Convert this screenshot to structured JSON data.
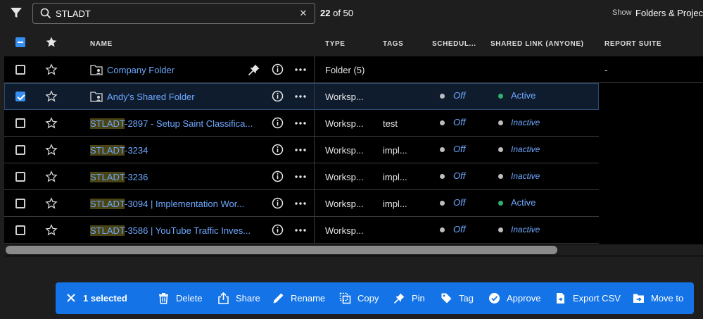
{
  "search": {
    "value": "STLADT",
    "clear_symbol": "✕"
  },
  "result_count": {
    "shown": "22",
    "of_label": "of 50"
  },
  "show": {
    "label": "Show",
    "value": "Folders & Projects"
  },
  "columns": {
    "name": "NAME",
    "type": "TYPE",
    "tags": "TAGS",
    "scheduled": "SCHEDUL...",
    "shared_link": "SHARED LINK (ANYONE)",
    "report_suite": "REPORT SUITE"
  },
  "rows": [
    {
      "name": "Company Folder",
      "highlight": "",
      "type": "Folder (5)",
      "tags": "",
      "scheduled": "",
      "link": "",
      "report_suite": "-",
      "checked": false,
      "pinned": true,
      "folder": true
    },
    {
      "name": "Andy's Shared Folder",
      "highlight": "",
      "type": "Worksp...",
      "tags": "",
      "scheduled": "Off",
      "link": "Active",
      "report_suite": "",
      "checked": true,
      "pinned": false,
      "folder": true
    },
    {
      "name": "-2897 - Setup Saint Classifica...",
      "highlight": "STLADT",
      "type": "Worksp...",
      "tags": "test",
      "scheduled": "Off",
      "link": "Inactive",
      "report_suite": "",
      "checked": false,
      "pinned": false,
      "folder": false
    },
    {
      "name": "-3234",
      "highlight": "STLADT",
      "type": "Worksp...",
      "tags": "impl...",
      "scheduled": "Off",
      "link": "Inactive",
      "report_suite": "",
      "checked": false,
      "pinned": false,
      "folder": false
    },
    {
      "name": "-3236",
      "highlight": "STLADT",
      "type": "Worksp...",
      "tags": "impl...",
      "scheduled": "Off",
      "link": "Inactive",
      "report_suite": "",
      "checked": false,
      "pinned": false,
      "folder": false
    },
    {
      "name": "-3094 | Implementation Wor...",
      "highlight": "STLADT",
      "type": "Worksp...",
      "tags": "impl...",
      "scheduled": "Off",
      "link": "Active",
      "report_suite": "",
      "checked": false,
      "pinned": false,
      "folder": false
    },
    {
      "name": "-3586 | YouTube Traffic Inves...",
      "highlight": "STLADT",
      "type": "Worksp...",
      "tags": "",
      "scheduled": "Off",
      "link": "Inactive",
      "report_suite": "",
      "checked": false,
      "pinned": false,
      "folder": false
    }
  ],
  "colors": {
    "active": "#2fb36b",
    "inactive": "#bdbdbd",
    "accent": "#1473e6",
    "link": "#6ea8fe"
  },
  "action_bar": {
    "selected": "1 selected",
    "delete": "Delete",
    "share": "Share",
    "rename": "Rename",
    "copy": "Copy",
    "pin": "Pin",
    "tag": "Tag",
    "approve": "Approve",
    "export_csv": "Export CSV",
    "move_to": "Move to"
  }
}
